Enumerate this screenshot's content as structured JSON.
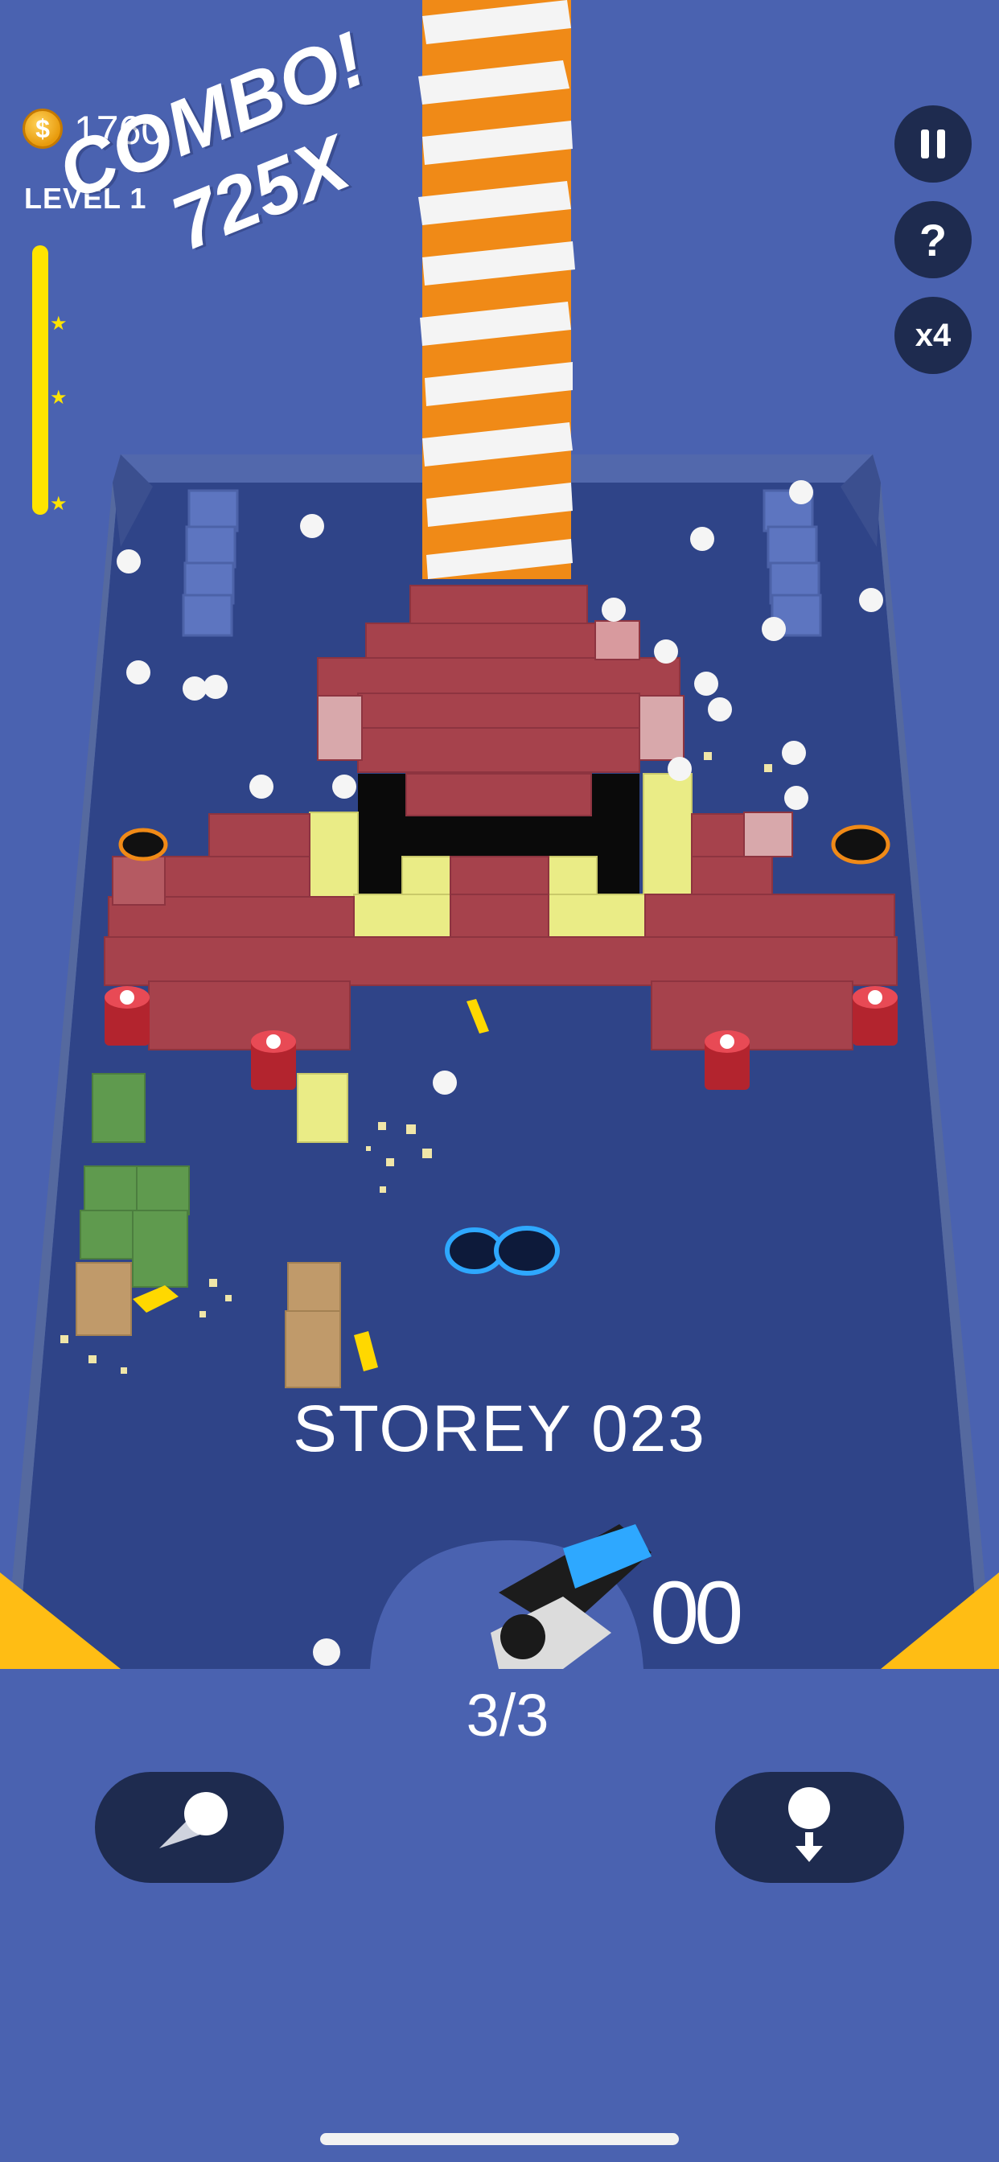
{
  "hud": {
    "coins": "1760",
    "coin_symbol": "$",
    "level_label": "LEVEL 1",
    "combo_line1": "COMBO!",
    "combo_line2": "725X",
    "level_progress_stars": 3,
    "pause_icon": "pause-icon",
    "help_label": "?",
    "speed_label": "x4"
  },
  "game": {
    "storey_label": "STOREY 023",
    "shots_label": "00",
    "ball_count": "3/3"
  },
  "controls": {
    "left_icon": "fast-shot-icon",
    "right_icon": "drop-ball-icon"
  },
  "colors": {
    "background": "#4a62b0",
    "board": "#2f4488",
    "brick_red": "#a6424c",
    "brick_yellow": "#eaec86",
    "accent_yellow": "#ffe400",
    "tower_orange": "#f08a17",
    "button_dark": "#1e2b4f"
  }
}
